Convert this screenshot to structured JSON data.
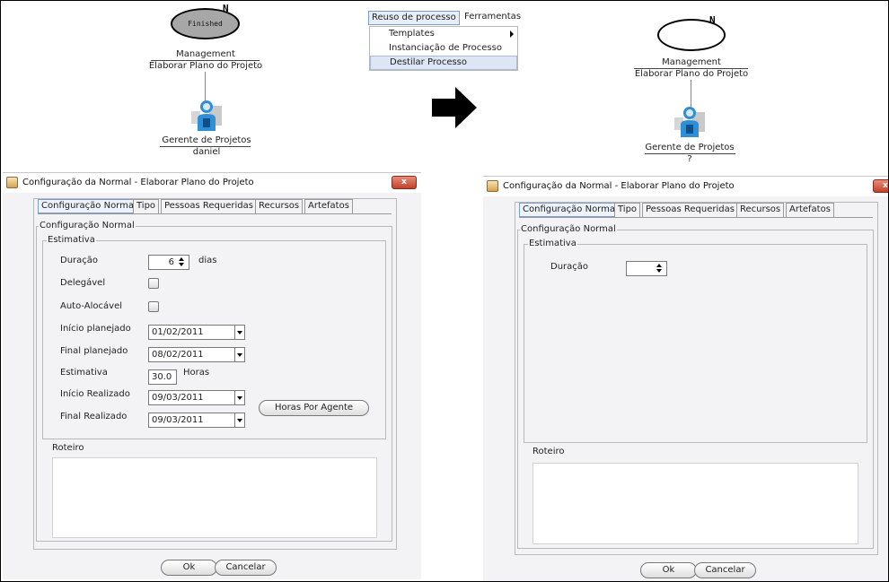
{
  "left_diagram": {
    "oval_status": "Finished",
    "oval_marker": "N",
    "activity_group": "Management",
    "activity_name": "Elaborar Plano do Projeto",
    "role": "Gerente de Projetos",
    "agent": "daniel"
  },
  "right_diagram": {
    "oval_marker": "N",
    "activity_group": "Management",
    "activity_name": "Elaborar Plano do Projeto",
    "role": "Gerente de Projetos",
    "agent": "?"
  },
  "menu": {
    "bar": [
      "Reuso de processo",
      "Ferramentas"
    ],
    "items": [
      "Templates",
      "Instanciação de Processo",
      "Destilar Processo"
    ]
  },
  "left_dialog": {
    "title": "Configuração da Normal -  Elaborar Plano do Projeto",
    "close": "x",
    "tabs": [
      "Configuração Normal",
      "Tipo",
      "Pessoas Requeridas",
      "Recursos",
      "Artefatos"
    ],
    "group_label": "Configuração Normal",
    "estimativa_label": "Estimativa",
    "fields": {
      "duracao_label": "Duração",
      "duracao_value": "6",
      "duracao_unit": "dias",
      "delegavel_label": "Delegável",
      "autoalocavel_label": "Auto-Alocável",
      "inicio_planejado_label": "Início planejado",
      "inicio_planejado_value": "01/02/2011",
      "final_planejado_label": "Final planejado",
      "final_planejado_value": "08/02/2011",
      "estimativa_label": "Estimativa",
      "estimativa_value": "30.0",
      "estimativa_unit": "Horas",
      "inicio_realizado_label": "Início Realizado",
      "inicio_realizado_value": "09/03/2011",
      "final_realizado_label": "Final Realizado",
      "final_realizado_value": "09/03/2011",
      "horas_por_agente": "Horas Por Agente"
    },
    "roteiro_label": "Roteiro",
    "ok": "Ok",
    "cancel": "Cancelar"
  },
  "right_dialog": {
    "title": "Configuração da Normal -  Elaborar Plano do Projeto",
    "close": "x",
    "tabs": [
      "Configuração Normal",
      "Tipo",
      "Pessoas Requeridas",
      "Recursos",
      "Artefatos"
    ],
    "group_label": "Configuração Normal",
    "estimativa_label": "Estimativa",
    "duracao_label": "Duração",
    "duracao_value": "",
    "roteiro_label": "Roteiro",
    "ok": "Ok",
    "cancel": "Cancelar"
  },
  "colors": {
    "oval_fill": "#a7a7a7",
    "close_button": "#c2412a",
    "menu_highlight": "#dce6f5",
    "dialog_bg": "#f3f3f5"
  }
}
